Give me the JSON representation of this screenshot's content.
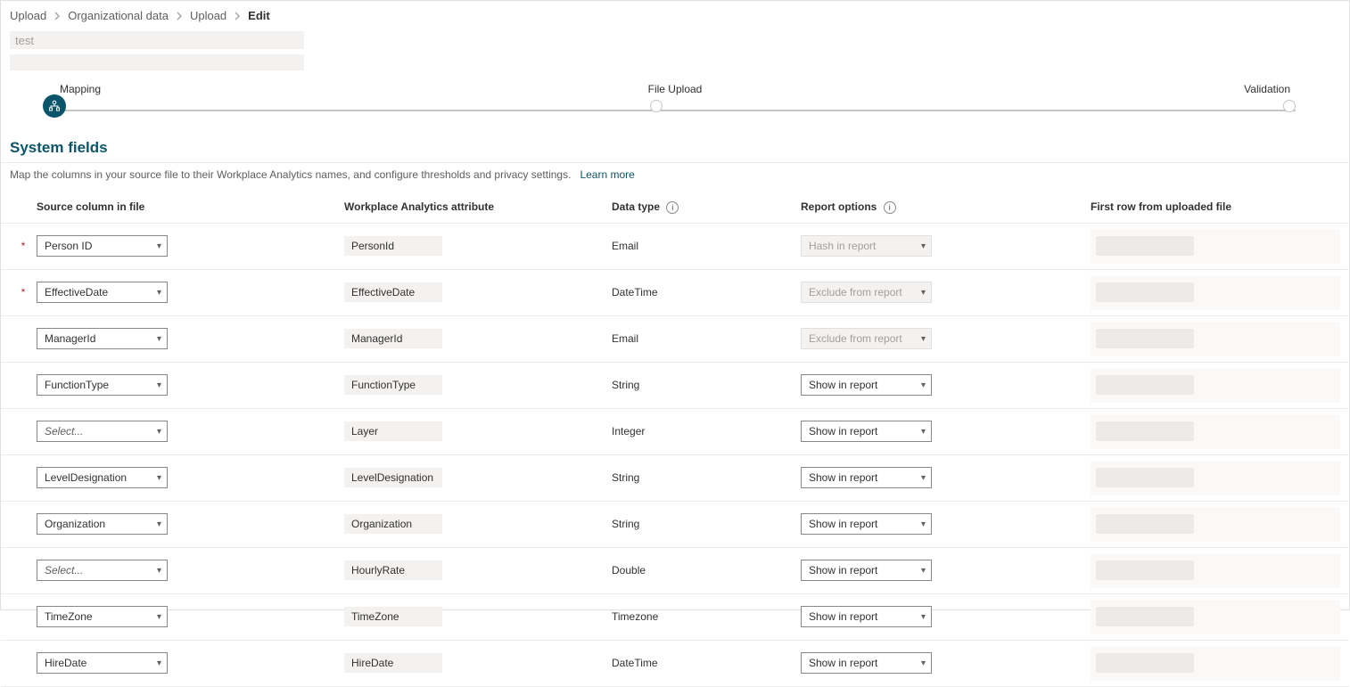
{
  "breadcrumb": [
    {
      "label": "Upload"
    },
    {
      "label": "Organizational data"
    },
    {
      "label": "Upload"
    },
    {
      "label": "Edit",
      "current": true
    }
  ],
  "title_text": "test",
  "stepper": {
    "step1": "Mapping",
    "step2": "File Upload",
    "step3": "Validation"
  },
  "section_heading": "System fields",
  "intro_text": "Map the columns in your source file to their Workplace Analytics names, and configure thresholds and privacy settings.",
  "learn_more": "Learn more",
  "columns": {
    "source": "Source column in file",
    "attribute": "Workplace Analytics attribute",
    "dtype": "Data type",
    "report": "Report options",
    "first": "First row from uploaded file"
  },
  "rows": [
    {
      "required": true,
      "source": "Person ID",
      "source_placeholder": false,
      "attr": "PersonId",
      "dtype": "Email",
      "report": "Hash in report",
      "report_disabled": true
    },
    {
      "required": true,
      "source": "EffectiveDate",
      "source_placeholder": false,
      "attr": "EffectiveDate",
      "dtype": "DateTime",
      "report": "Exclude from report",
      "report_disabled": true
    },
    {
      "required": false,
      "source": "ManagerId",
      "source_placeholder": false,
      "attr": "ManagerId",
      "dtype": "Email",
      "report": "Exclude from report",
      "report_disabled": true
    },
    {
      "required": false,
      "source": "FunctionType",
      "source_placeholder": false,
      "attr": "FunctionType",
      "dtype": "String",
      "report": "Show in report",
      "report_disabled": false
    },
    {
      "required": false,
      "source": "Select...",
      "source_placeholder": true,
      "attr": "Layer",
      "dtype": "Integer",
      "report": "Show in report",
      "report_disabled": false
    },
    {
      "required": false,
      "source": "LevelDesignation",
      "source_placeholder": false,
      "attr": "LevelDesignation",
      "dtype": "String",
      "report": "Show in report",
      "report_disabled": false
    },
    {
      "required": false,
      "source": "Organization",
      "source_placeholder": false,
      "attr": "Organization",
      "dtype": "String",
      "report": "Show in report",
      "report_disabled": false
    },
    {
      "required": false,
      "source": "Select...",
      "source_placeholder": true,
      "attr": "HourlyRate",
      "dtype": "Double",
      "report": "Show in report",
      "report_disabled": false
    },
    {
      "required": false,
      "source": "TimeZone",
      "source_placeholder": false,
      "attr": "TimeZone",
      "dtype": "Timezone",
      "report": "Show in report",
      "report_disabled": false
    },
    {
      "required": false,
      "source": "HireDate",
      "source_placeholder": false,
      "attr": "HireDate",
      "dtype": "DateTime",
      "report": "Show in report",
      "report_disabled": false
    }
  ]
}
